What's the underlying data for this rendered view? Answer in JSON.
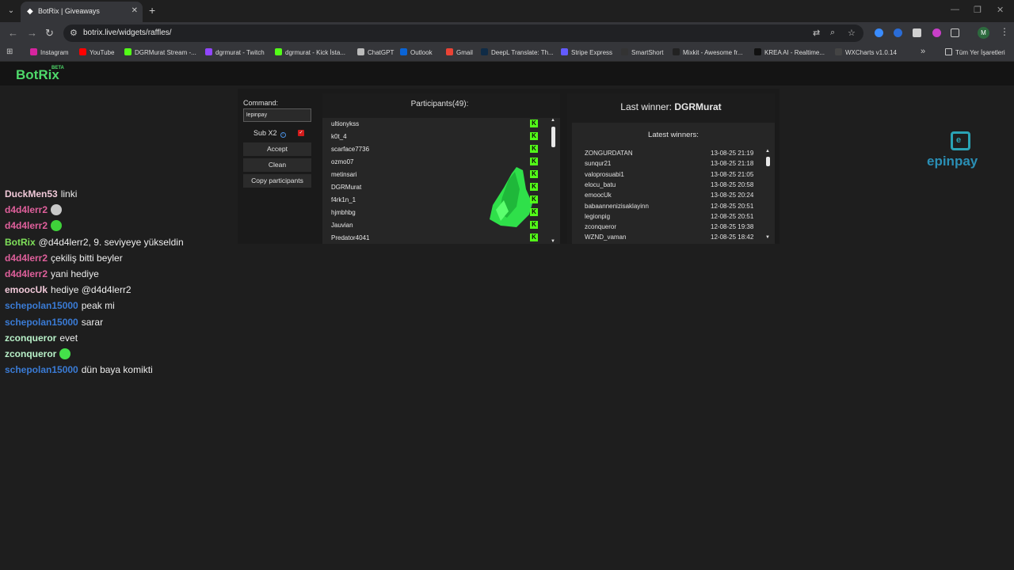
{
  "browser": {
    "tab_title": "BotRix | Giveaways",
    "url": "botrix.live/widgets/raffles/",
    "profile_initial": "M",
    "bookmarks": [
      {
        "label": "Instagram",
        "color": "#d6249f"
      },
      {
        "label": "YouTube",
        "color": "#ff0000"
      },
      {
        "label": "DGRMurat Stream -...",
        "color": "#53fc18"
      },
      {
        "label": "dgrmurat - Twitch",
        "color": "#9146ff"
      },
      {
        "label": "dgrmurat - Kick İsta...",
        "color": "#53fc18"
      },
      {
        "label": "ChatGPT",
        "color": "#bbbbbb"
      },
      {
        "label": "Outlook",
        "color": "#0a64d6"
      },
      {
        "label": "Gmail",
        "color": "#ea4335"
      },
      {
        "label": "DeepL Translate: Th...",
        "color": "#0f2b46"
      },
      {
        "label": "Stripe Express",
        "color": "#635bff"
      },
      {
        "label": "SmartShort",
        "color": "#333333"
      },
      {
        "label": "Mixkit - Awesome fr...",
        "color": "#222222"
      },
      {
        "label": "KREA AI - Realtime...",
        "color": "#111111"
      },
      {
        "label": "WXCharts v1.0.14",
        "color": "#444444"
      }
    ],
    "all_bookmarks_label": "Tüm Yer İşaretleri"
  },
  "brand": {
    "name": "BotRix",
    "badge": "BETA"
  },
  "widget": {
    "command_label": "Command:",
    "command_value": "lepinpay",
    "sub_label": "Sub X2",
    "accept_label": "Accept",
    "clean_label": "Clean",
    "copy_label": "Copy participants",
    "participants_title": "Participants(49):",
    "participants": [
      "ultionykss",
      "k0t_4",
      "scarface7736",
      "ozmo07",
      "metinsari",
      "DGRMurat",
      "f4rk1n_1",
      "hjmbhbg",
      "Jauvian",
      "Predator4041"
    ],
    "last_winner_label": "Last winner:",
    "last_winner_name": "DGRMurat",
    "latest_winners_title": "Latest winners:",
    "winners": [
      {
        "name": "ZONGURDATAN",
        "time": "13-08-25 21:19"
      },
      {
        "name": "sunqur21",
        "time": "13-08-25 21:18"
      },
      {
        "name": "valoprosuabi1",
        "time": "13-08-25 21:05"
      },
      {
        "name": "elocu_batu",
        "time": "13-08-25 20:58"
      },
      {
        "name": "emoocUk",
        "time": "13-08-25 20:24"
      },
      {
        "name": "babaannenizisaklayinn",
        "time": "12-08-25 20:51"
      },
      {
        "name": "legionpig",
        "time": "12-08-25 20:51"
      },
      {
        "name": "zconqueror",
        "time": "12-08-25 19:38"
      },
      {
        "name": "WZND_vaman",
        "time": "12-08-25 18:42"
      }
    ]
  },
  "sponsor": {
    "name": "epinpay",
    "icon_letter": "e"
  },
  "chat": [
    {
      "user": "DuckMen53",
      "color": "#f0c8d8",
      "msg": "linki",
      "emote": ""
    },
    {
      "user": "d4d4lerr2",
      "color": "#e0609c",
      "msg": "",
      "emote": "#c8c8c8"
    },
    {
      "user": "d4d4lerr2",
      "color": "#e0609c",
      "msg": "",
      "emote": "#3fd13a"
    },
    {
      "user": "BotRix",
      "color": "#7fe05a",
      "msg": "@d4d4lerr2, 9. seviyeye yükseldin",
      "emote": ""
    },
    {
      "user": "d4d4lerr2",
      "color": "#e0609c",
      "msg": "çekiliş bitti beyler",
      "emote": ""
    },
    {
      "user": "d4d4lerr2",
      "color": "#e0609c",
      "msg": "yani hediye",
      "emote": ""
    },
    {
      "user": "emoocUk",
      "color": "#f0c8d8",
      "msg": "hediye @d4d4lerr2",
      "emote": ""
    },
    {
      "user": "schepolan15000",
      "color": "#3a7bd5",
      "msg": "peak mi",
      "emote": ""
    },
    {
      "user": "schepolan15000",
      "color": "#3a7bd5",
      "msg": "sarar",
      "emote": ""
    },
    {
      "user": "zconqueror",
      "color": "#b8f0c8",
      "msg": "evet",
      "emote": ""
    },
    {
      "user": "zconqueror",
      "color": "#b8f0c8",
      "msg": "",
      "emote": "#44e04a"
    },
    {
      "user": "schepolan15000",
      "color": "#3a7bd5",
      "msg": "dün baya komikti",
      "emote": ""
    }
  ]
}
